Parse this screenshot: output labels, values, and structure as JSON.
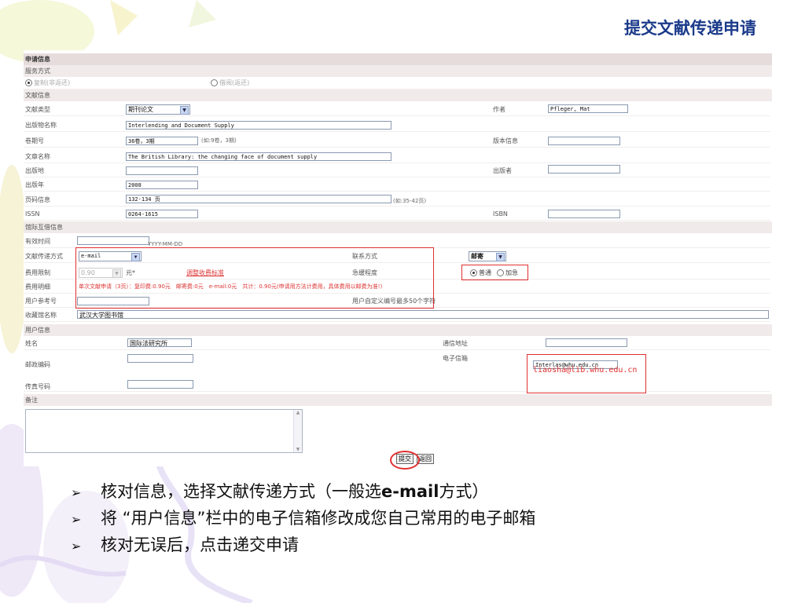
{
  "slide": {
    "title": "提交文献传递申请",
    "bullets": [
      {
        "pre": "核对信息，选择文献传递方式（一般选",
        "bold": "e-mail",
        "post": "方式）"
      },
      {
        "pre": "将 “用户信息”栏中的电子信箱修改成您自己常用的电子邮箱",
        "bold": "",
        "post": ""
      },
      {
        "pre": "核对无误后，点击递交申请",
        "bold": "",
        "post": ""
      }
    ]
  },
  "form": {
    "section_apply": "申请信息",
    "service_mode_label": "服务方式",
    "service_copy": "复制(非返还)",
    "service_loan": "借阅(返还)",
    "section_doc": "文献信息",
    "doc_type_label": "文献类型",
    "doc_type_value": "期刊论文",
    "author_label": "作者",
    "author_value": "Pfleger, Mat",
    "pub_title_label": "出版物名称",
    "pub_title_value": "Interlending and Document Supply",
    "volume_label": "卷期号",
    "volume_value": "36卷，3期",
    "volume_hint": "(如:9卷，3期)",
    "edition_label": "版本信息",
    "article_label": "文章名称",
    "article_value": "The British Library: the changing face of document supply",
    "place_label": "出版地",
    "publisher_label": "出版者",
    "year_label": "出版年",
    "year_value": "2008",
    "pages_label": "页码信息",
    "pages_value": "132-134 页",
    "pages_hint": "(如:35-42页)",
    "issn_label": "ISSN",
    "issn_value": "0264-1615",
    "isbn_label": "ISBN",
    "section_ill": "馆际互借信息",
    "valid_label": "有效时间",
    "valid_hint": "YYYY-MM-DD",
    "delivery_label": "文献传递方式",
    "delivery_value": "e-mail",
    "contact_label": "联系方式",
    "contact_value": "邮寄",
    "fee_limit_label": "费用限制",
    "fee_limit_value": "0.90",
    "fee_unit": "元*",
    "fee_link": "调整收费标准",
    "urgency_label": "急缓程度",
    "urgency_normal": "普通",
    "urgency_urgent": "加急",
    "fee_desc_label": "费用明细",
    "fee_desc_value": "单次文献申请（3页）：复印费:0.90元　邮寄费:0元　e-mail:0元　共计：0.90元(申请用方法计费用，具体费用以邮费为准!)",
    "user_ref_label": "用户参考号",
    "user_ref_hint": "用户自定义编号最多50个字符",
    "library_label": "收藏馆名称",
    "library_value": "武汉大学图书馆",
    "section_user": "用户信息",
    "name_label": "姓名",
    "name_value": "国际法研究所",
    "address_label": "通信地址",
    "zip_label": "邮政编码",
    "email_label": "电子信箱",
    "email_value": "Interlas@whu.edu.cn",
    "email_override": "liaosha@lib.whu.edu.cn",
    "fax_label": "传真号码",
    "remark_label": "备注",
    "submit_label": "提交",
    "back_label": "返回"
  },
  "colors": {
    "title": "#1a3a8a",
    "section_bg": "#e6dcdc",
    "highlight": "#e03030"
  }
}
